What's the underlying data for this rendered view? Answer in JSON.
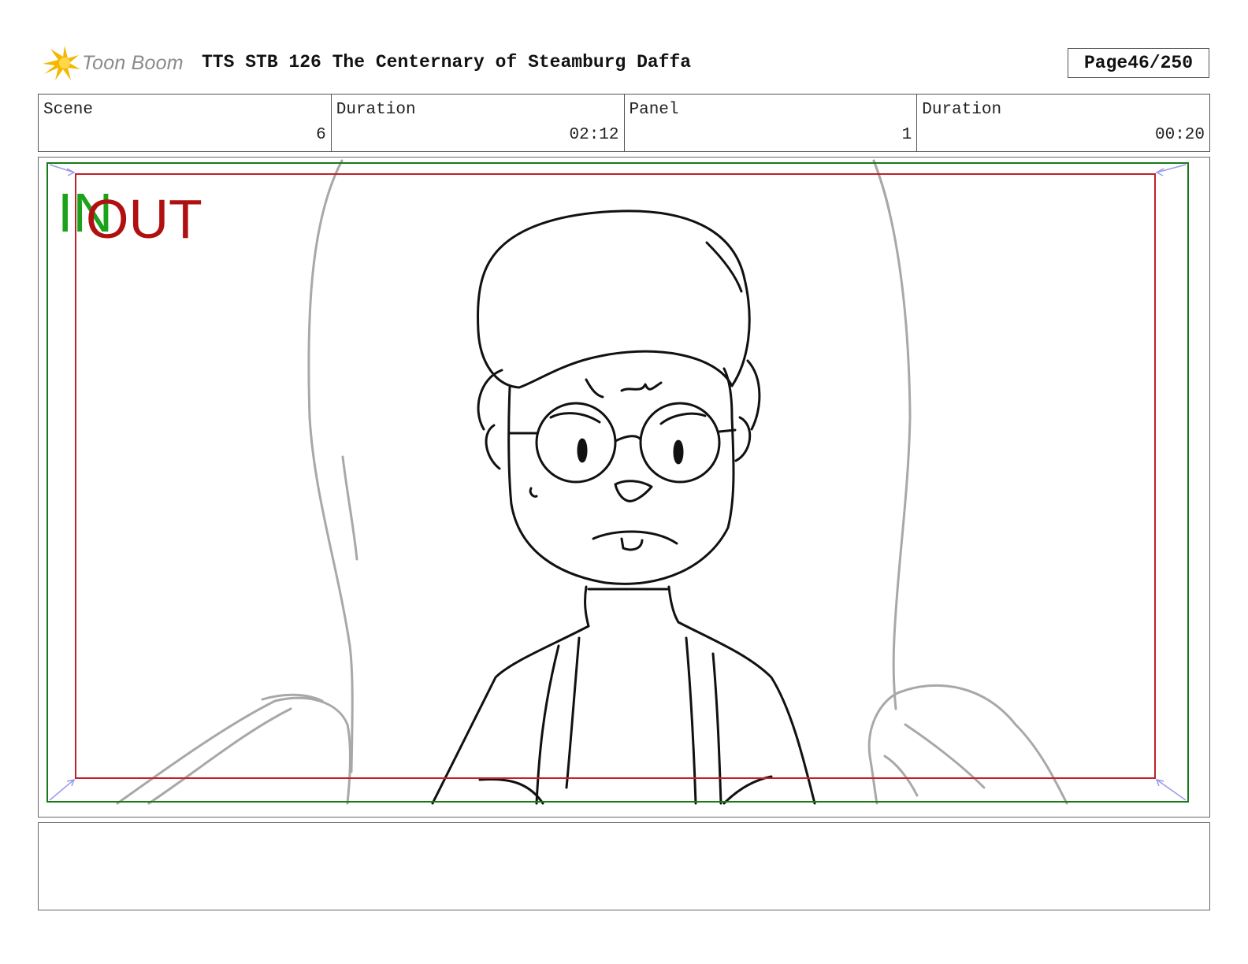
{
  "header": {
    "logo_text": "Toon Boom",
    "title": "TTS STB 126 The Centernary of Steamburg Daffa",
    "page_label": "Page",
    "page_value": "46/250"
  },
  "info": {
    "scene_label": "Scene",
    "scene_value": "6",
    "scene_duration_label": "Duration",
    "scene_duration_value": "02:12",
    "panel_label": "Panel",
    "panel_value": "1",
    "panel_duration_label": "Duration",
    "panel_duration_value": "00:20"
  },
  "panel": {
    "in_label": "IN",
    "out_label": "OUT",
    "colors": {
      "in": "#1aa31a",
      "out": "#b01010",
      "safe_frame": "#1a7a1a",
      "action_frame": "#c0202a"
    }
  },
  "notes": {
    "text": ""
  }
}
